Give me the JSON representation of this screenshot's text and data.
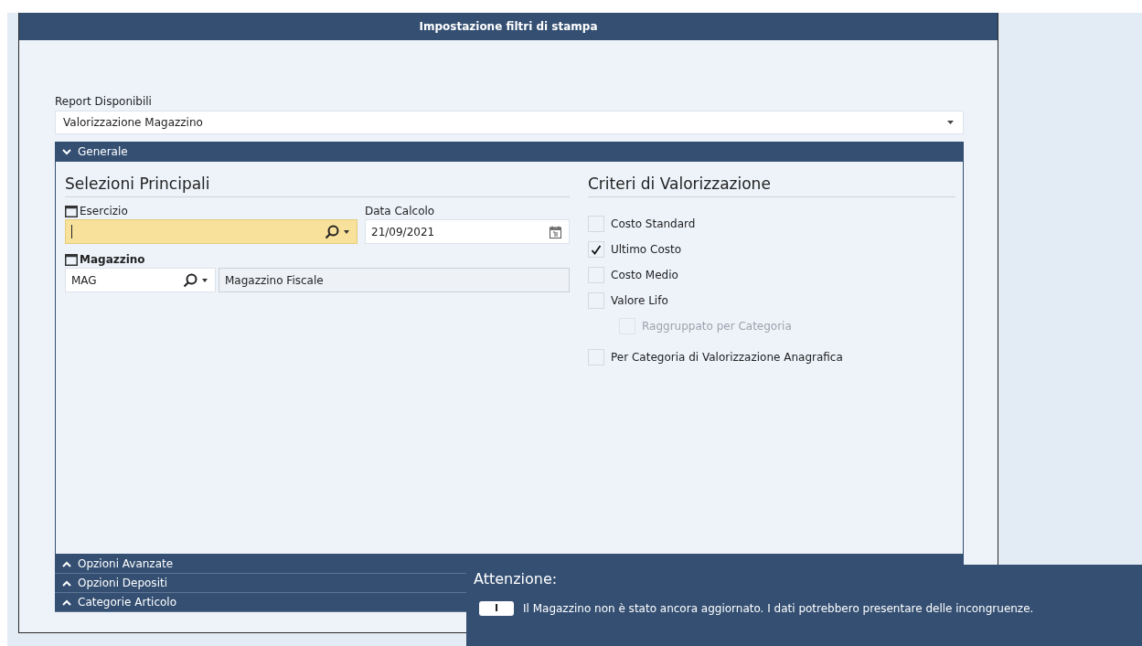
{
  "window": {
    "title": "Impostazione filtri di stampa"
  },
  "report": {
    "label": "Report Disponibili",
    "value": "Valorizzazione Magazzino"
  },
  "sections": [
    {
      "title": "Generale",
      "expanded": true
    },
    {
      "title": "Opzioni Avanzate",
      "expanded": false
    },
    {
      "title": "Opzioni Depositi",
      "expanded": false
    },
    {
      "title": "Categorie Articolo",
      "expanded": false
    }
  ],
  "main_selections": {
    "title": "Selezioni Principali",
    "esercizio": {
      "label": "Esercizio",
      "focused": true
    },
    "data_calcolo": {
      "label": "Data Calcolo",
      "value": "21/09/2021"
    },
    "magazzino": {
      "label": "Magazzino",
      "code": "MAG",
      "description": "Magazzino Fiscale"
    }
  },
  "criteria": {
    "title": "Criteri di Valorizzazione",
    "options": [
      {
        "label": "Costo Standard",
        "checked": false,
        "disabled": false
      },
      {
        "label": "Ultimo Costo",
        "checked": true,
        "disabled": false
      },
      {
        "label": "Costo Medio",
        "checked": false,
        "disabled": false
      },
      {
        "label": "Valore Lifo",
        "checked": false,
        "disabled": false,
        "children": [
          {
            "label": "Raggruppato per Categoria",
            "checked": false,
            "disabled": true
          }
        ]
      },
      {
        "label": "Per Categoria di Valorizzazione Anagrafica",
        "checked": false,
        "disabled": false
      }
    ]
  },
  "notification": {
    "title": "Attenzione:",
    "badge": "I",
    "message": "Il Magazzino non è stato ancora aggiornato. I dati potrebbero presentare delle incongruenze."
  }
}
